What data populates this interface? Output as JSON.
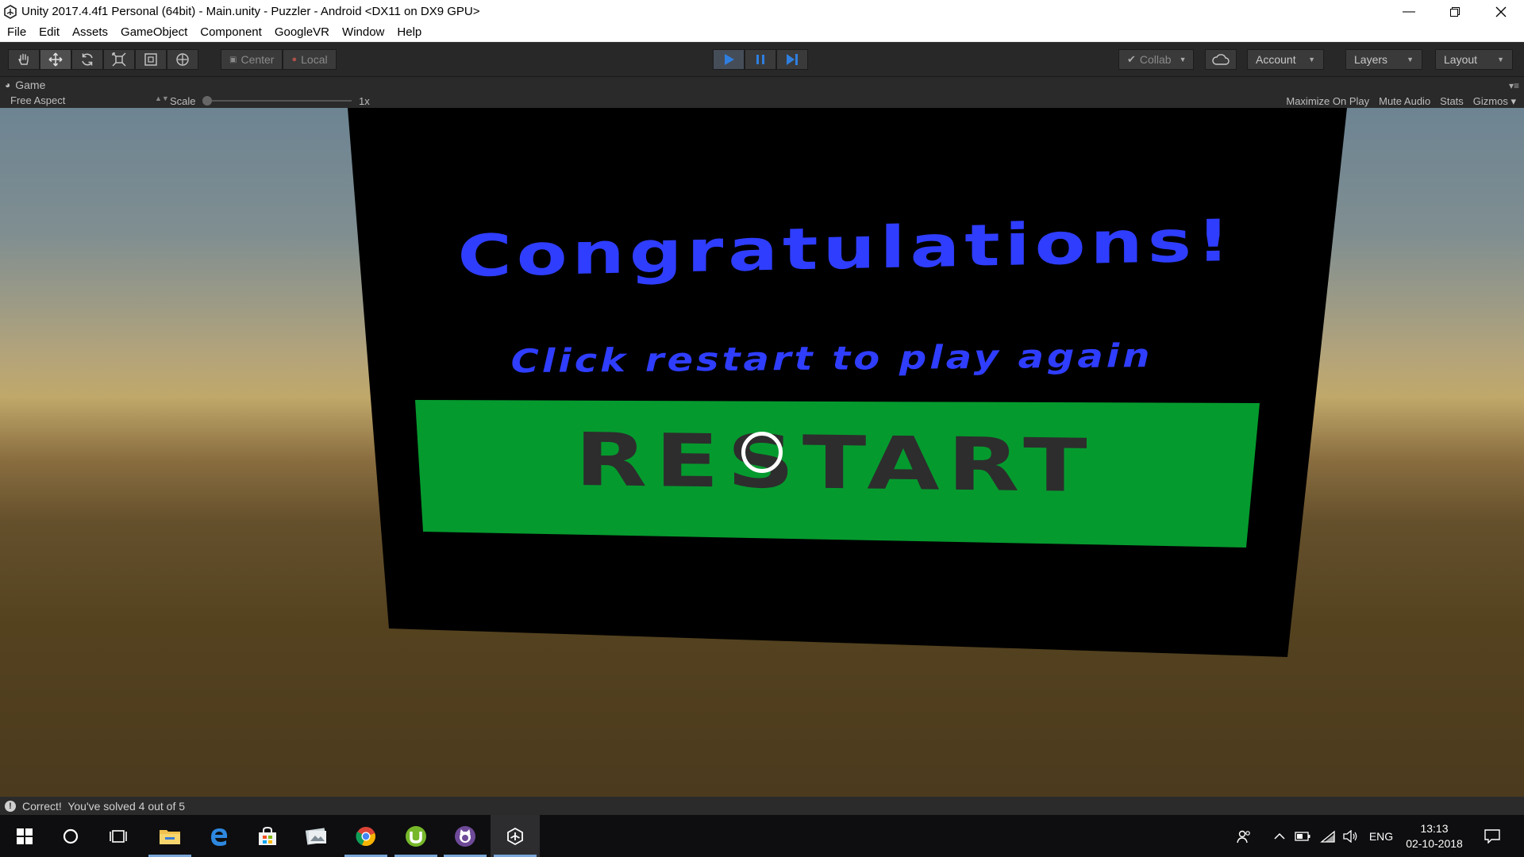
{
  "window": {
    "title": "Unity 2017.4.4f1 Personal (64bit) - Main.unity - Puzzler - Android <DX11 on DX9 GPU>",
    "controls": [
      "minimize-icon",
      "restore-icon",
      "close-icon"
    ]
  },
  "menu": {
    "items": [
      "File",
      "Edit",
      "Assets",
      "GameObject",
      "Component",
      "GoogleVR",
      "Window",
      "Help"
    ]
  },
  "toolbar": {
    "transform_tools": [
      "hand-tool-icon",
      "move-tool-icon",
      "rotate-tool-icon",
      "scale-tool-icon",
      "rect-tool-icon",
      "transform-tool-icon"
    ],
    "pivot_label": "Center",
    "space_label": "Local",
    "collab_label": "Collab",
    "account_label": "Account",
    "layers_label": "Layers",
    "layout_label": "Layout",
    "play_active": true,
    "accent_color": "#2f7fe0"
  },
  "game_panel": {
    "tab_label": "Game",
    "aspect_label": "Free Aspect",
    "scale_label": "Scale",
    "scale_value": "1x",
    "options": [
      "Maximize On Play",
      "Mute Audio",
      "Stats",
      "Gizmos"
    ]
  },
  "scene": {
    "title": "Congratulations!",
    "subtitle": "Click restart to play again",
    "button_label": "RESTART",
    "title_color": "#2f3dff",
    "button_color": "#059a2e"
  },
  "status": {
    "message": "Correct!  You've solved 4 out of 5"
  },
  "taskbar": {
    "apps": [
      "windows-start-icon",
      "cortana-icon",
      "task-view-icon",
      "file-explorer-icon",
      "edge-icon",
      "store-icon",
      "photos-icon",
      "chrome-icon",
      "utorrent-icon",
      "github-icon",
      "unity-icon"
    ],
    "language": "ENG",
    "time": "13:13",
    "date": "02-10-2018"
  }
}
